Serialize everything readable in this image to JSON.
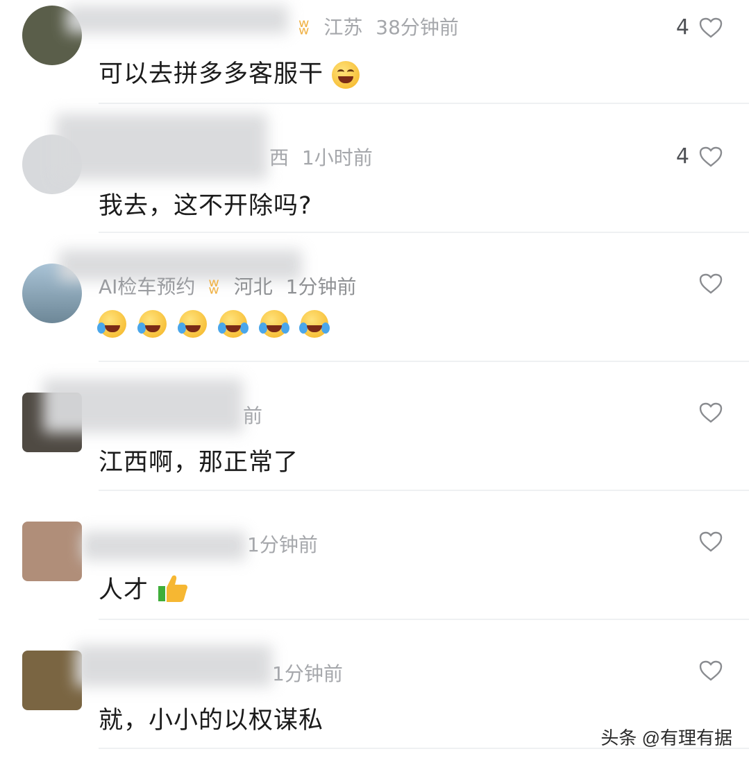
{
  "comments": [
    {
      "name": "",
      "location": "江苏",
      "time": "38分钟前",
      "text": "可以去拼多多客服干",
      "likes": "4"
    },
    {
      "name": "",
      "location": "西",
      "time": "1小时前",
      "text": "我去，这不开除吗?",
      "likes": "4"
    },
    {
      "name": "AI检车预约",
      "location": "河北",
      "time": "1分钟前",
      "text": "",
      "likes": ""
    },
    {
      "name": "",
      "location": "",
      "time": "前",
      "text": "江西啊，那正常了",
      "likes": ""
    },
    {
      "name": "",
      "location": "",
      "time": "1分钟前",
      "text": "人才",
      "likes": ""
    },
    {
      "name": "",
      "location": "",
      "time": "1分钟前",
      "text": "就，小小的以权谋私",
      "likes": ""
    }
  ],
  "icons": {
    "heart": "heart-outline-icon",
    "badge": "creator-badge-icon",
    "grin": "grinning-face-emoji",
    "facepalm": "facepalm-laugh-emoji",
    "tears": "tears-of-joy-emoji",
    "thumbs": "thumbs-up-emoji"
  },
  "watermark": "头条 @有理有据"
}
